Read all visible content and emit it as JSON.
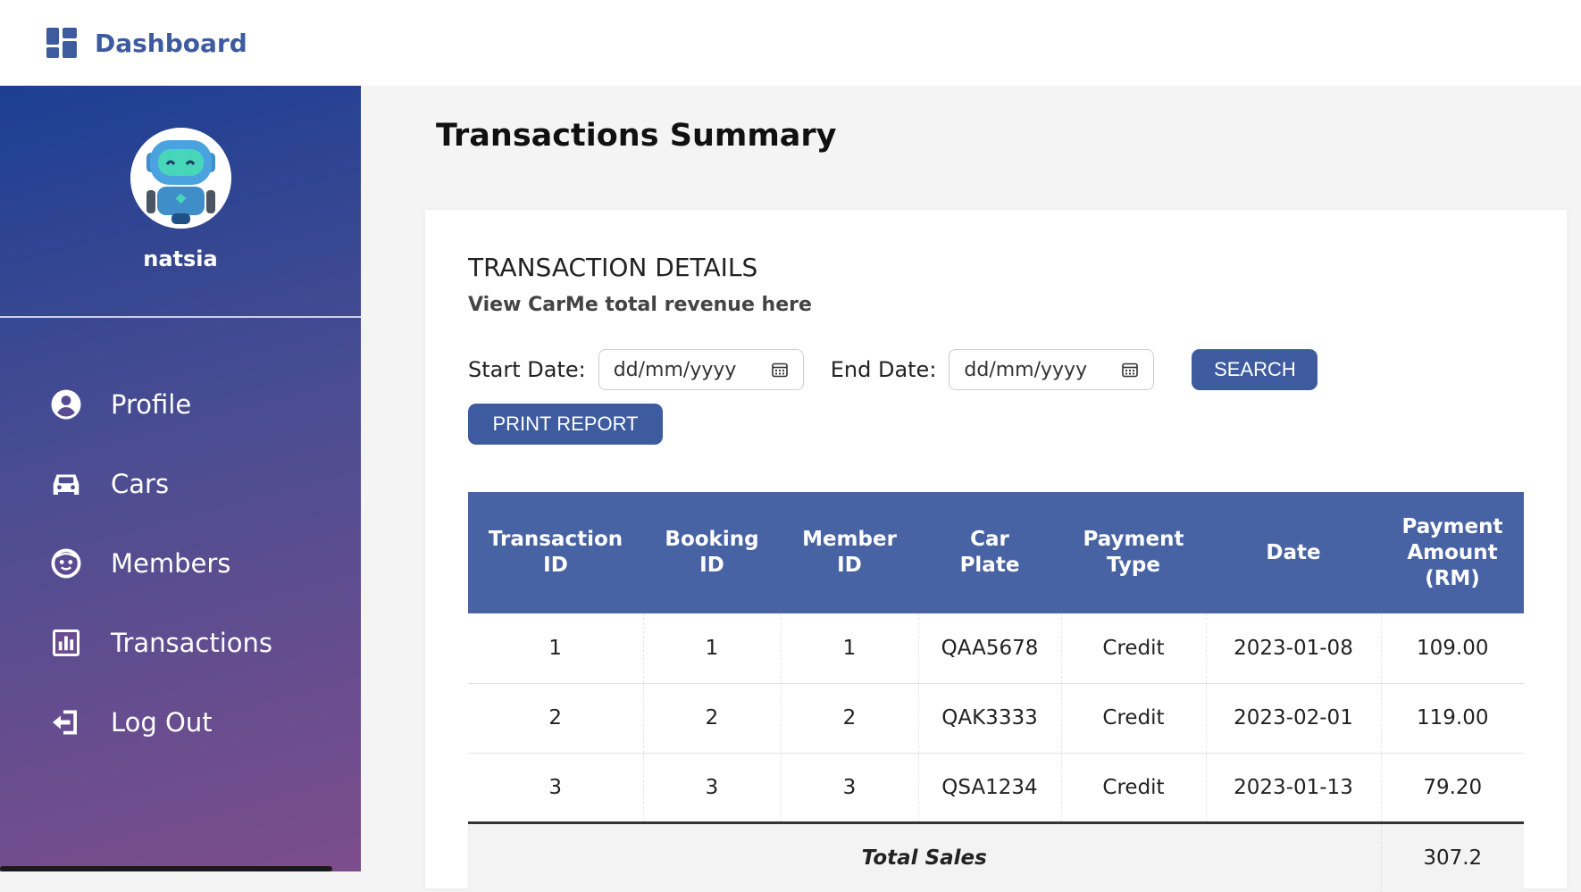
{
  "topbar": {
    "brand_label": "Dashboard"
  },
  "sidebar": {
    "username": "natsia",
    "items": [
      {
        "label": "Profile",
        "icon": "user-circle-icon"
      },
      {
        "label": "Cars",
        "icon": "car-icon"
      },
      {
        "label": "Members",
        "icon": "face-icon"
      },
      {
        "label": "Transactions",
        "icon": "chart-icon"
      },
      {
        "label": "Log Out",
        "icon": "logout-icon"
      }
    ]
  },
  "main": {
    "page_title": "Transactions Summary",
    "card_title": "TRANSACTION DETAILS",
    "card_subtitle": "View CarMe total revenue here",
    "start_label": "Start Date:",
    "start_placeholder": "dd/mm/yyyy",
    "end_label": "End Date:",
    "end_placeholder": "dd/mm/yyyy",
    "search_label": "SEARCH",
    "print_label": "PRINT REPORT"
  },
  "table": {
    "headers": [
      [
        "Transaction",
        "ID"
      ],
      [
        "Booking",
        "ID"
      ],
      [
        "Member",
        "ID"
      ],
      [
        "Car",
        "Plate"
      ],
      [
        "Payment",
        "Type"
      ],
      [
        "Date"
      ],
      [
        "Payment",
        "Amount",
        "(RM)"
      ]
    ],
    "rows": [
      [
        "1",
        "1",
        "1",
        "QAA5678",
        "Credit",
        "2023-01-08",
        "109.00"
      ],
      [
        "2",
        "2",
        "2",
        "QAK3333",
        "Credit",
        "2023-02-01",
        "119.00"
      ],
      [
        "3",
        "3",
        "3",
        "QSA1234",
        "Credit",
        "2023-01-13",
        "79.20"
      ]
    ],
    "total_label": "Total Sales",
    "total_value": "307.2"
  },
  "colors": {
    "accent": "#3e5ba0",
    "header_bg": "#4863a4"
  }
}
